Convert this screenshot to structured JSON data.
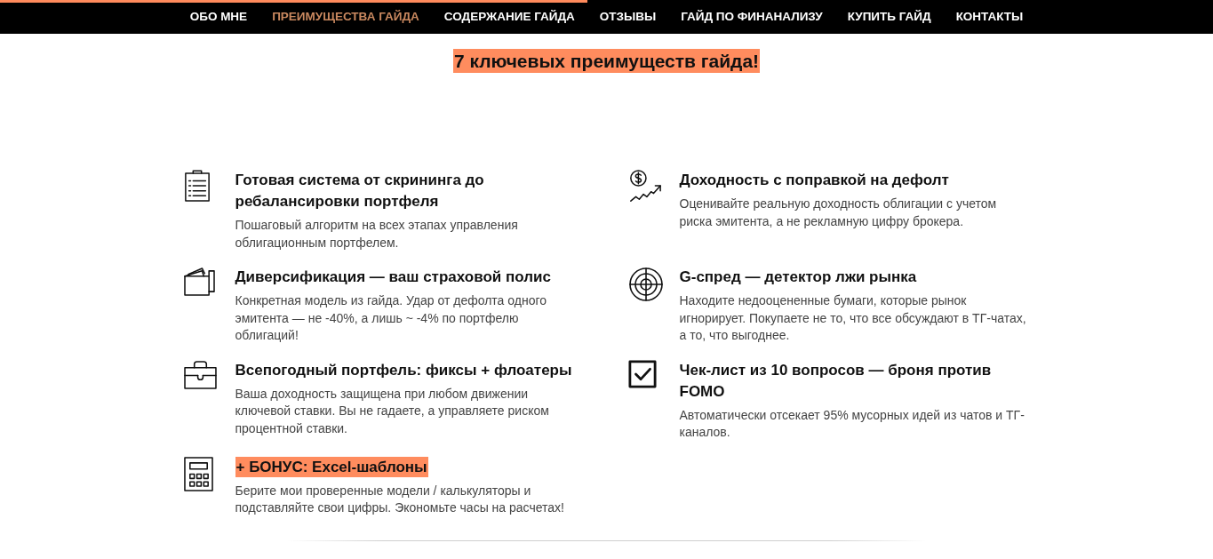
{
  "scroll_progress": {
    "level": 0.484
  },
  "nav": {
    "items": [
      {
        "label": "ОБО МНЕ",
        "selected": false
      },
      {
        "label": "ПРЕИМУЩЕСТВА ГАЙДА",
        "selected": true
      },
      {
        "label": "СОДЕРЖАНИЕ ГАЙДА",
        "selected": false
      },
      {
        "label": "ОТЗЫВЫ",
        "selected": false
      },
      {
        "label": "ГАЙД ПО ФИНАНАЛИЗУ",
        "selected": false
      },
      {
        "label": "КУПИТЬ ГАЙД",
        "selected": false
      },
      {
        "label": "КОНТАКТЫ",
        "selected": false
      }
    ]
  },
  "heading": "7 ключевых преимуществ гайда!",
  "features": [
    {
      "title": "Готовая система от скрининга до ребалансировки портфеля",
      "description": "Пошаговый алгоритм на всех этапах управления облигационным портфелем.",
      "highlighted": false
    },
    {
      "title": "Доходность с поправкой на дефолт",
      "description": "Оценивайте реальную доходность облигации с учетом риска эмитента, а не рекламную цифру брокера.",
      "highlighted": false
    },
    {
      "title": "Диверсификация — ваш страховой полис",
      "description": "Конкретная модель из гайда. Удар от дефолта одного эмитента — не -40%, а лишь ~ -4% по портфелю облигаций!",
      "highlighted": false
    },
    {
      "title": "G-спред — детектор лжи рынка",
      "description": "Находите недооцененные бумаги, которые рынок игнорирует. Покупаете не то, что все обсуждают в ТГ-чатах, а то, что выгоднее.",
      "highlighted": false
    },
    {
      "title": "Всепогодный портфель: фиксы + флоатеры",
      "description": "Ваша доходность защищена при любом движении ключевой ставки. Вы не гадаете, а управляете риском процентной ставки.",
      "highlighted": false
    },
    {
      "title": "Чек-лист из 10 вопросов — броня против FOMO",
      "description": "Автоматически отсекает 95% мусорных идей из чатов и ТГ-каналов.",
      "highlighted": false
    },
    {
      "title": "+ БОНУС: Excel-шаблоны",
      "description": "Берите мои проверенные модели / калькуляторы и подставляйте свои цифры. Экономьте часы на расчетах!",
      "highlighted": true
    }
  ]
}
